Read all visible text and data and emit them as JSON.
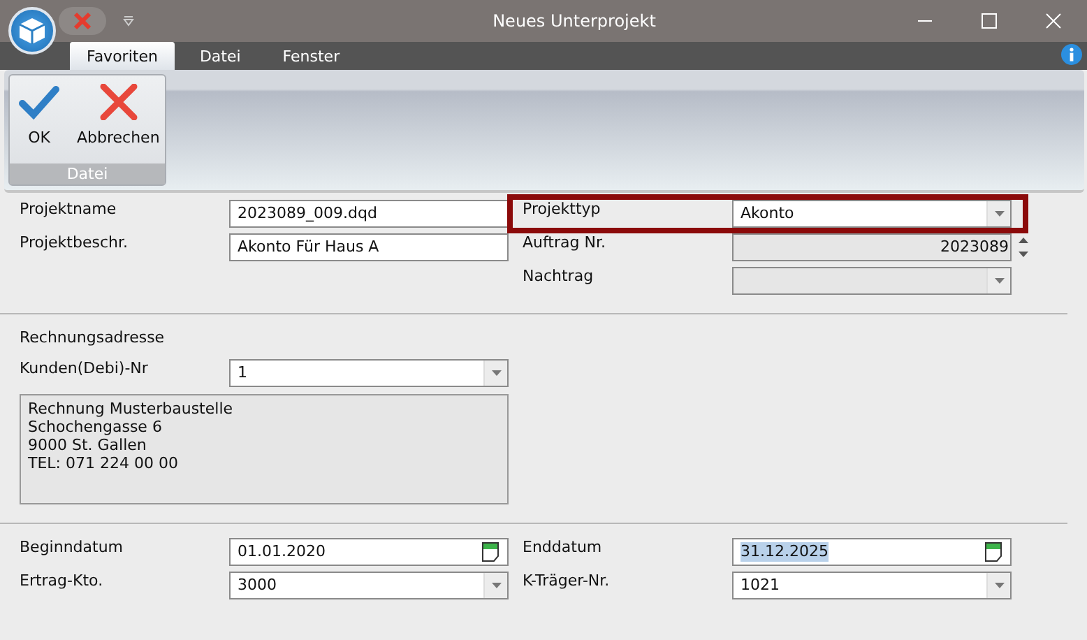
{
  "window": {
    "title": "Neues Unterprojekt"
  },
  "tabs": [
    {
      "label": "Favoriten",
      "selected": true
    },
    {
      "label": "Datei",
      "selected": false
    },
    {
      "label": "Fenster",
      "selected": false
    }
  ],
  "ribbon": {
    "group": "Datei",
    "buttons": [
      {
        "label": "OK",
        "kind": "ok"
      },
      {
        "label": "Abbrechen",
        "kind": "cancel"
      }
    ]
  },
  "project": {
    "left": [
      {
        "label": "Projektname",
        "kind": "text",
        "value": "2023089_009.dqd",
        "disabled": false,
        "highlighted": false
      },
      {
        "label": "Projektbeschr.",
        "kind": "text",
        "value": "Akonto Für Haus A",
        "disabled": false,
        "highlighted": false
      }
    ],
    "right": [
      {
        "label": "Projekttyp",
        "kind": "combo",
        "value": "Akonto",
        "disabled": false,
        "highlighted": true
      },
      {
        "label": "Auftrag Nr.",
        "kind": "spin",
        "value": "2023089",
        "disabled": true,
        "highlighted": false
      },
      {
        "label": "Nachtrag",
        "kind": "combo",
        "disabled": true,
        "highlighted": false
      }
    ]
  },
  "billing": {
    "title": "Rechnungsadresse",
    "customer": {
      "label": "Kunden(Debi)-Nr",
      "kind": "combo",
      "value": "1",
      "disabled": false
    },
    "address": [
      "Rechnung Musterbaustelle",
      "Schochengasse 6",
      "9000 St. Gallen",
      "TEL: 071 224 00 00"
    ]
  },
  "dates": {
    "left": [
      {
        "label": "Beginndatum",
        "kind": "date",
        "value": "01.01.2020",
        "disabled": false,
        "text_selected": false
      },
      {
        "label": "Ertrag-Kto.",
        "kind": "combo",
        "value": "3000",
        "disabled": false,
        "text_selected": false
      }
    ],
    "right": [
      {
        "label": "Enddatum",
        "kind": "date",
        "value": "31.12.2025",
        "disabled": false,
        "text_selected": true
      },
      {
        "label": "K-Träger-Nr.",
        "kind": "combo",
        "value": "1021",
        "disabled": false,
        "text_selected": false
      }
    ]
  }
}
